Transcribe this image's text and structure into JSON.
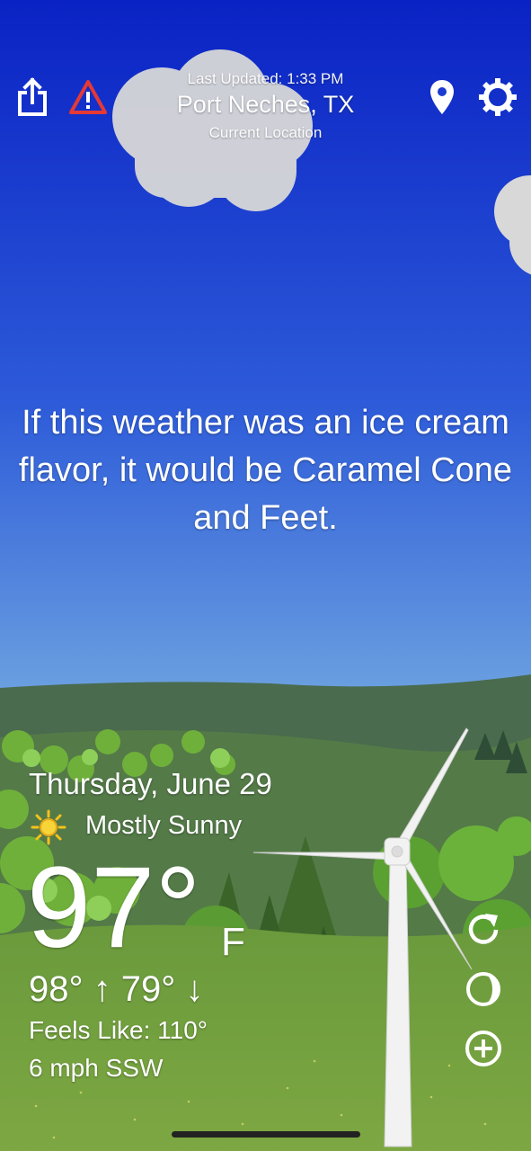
{
  "header": {
    "last_updated": "Last Updated: 1:33 PM",
    "city": "Port Neches, TX",
    "location_sub": "Current Location",
    "icons": [
      "share-icon",
      "alert-icon",
      "location-pin-icon",
      "gear-icon"
    ],
    "alert_color": "#e53935"
  },
  "quote": {
    "text": "If this weather was an ice cream flavor, it would be Caramel Cone and Feet."
  },
  "weather": {
    "date": "Thursday, June 29",
    "condition": "Mostly Sunny",
    "condition_icon": "sun-icon",
    "temperature": "97°",
    "unit": "F",
    "hi_lo": "98° ↑ 79° ↓",
    "feels_like": "Feels Like: 110°",
    "wind": "6 mph SSW"
  },
  "controls": {
    "icons": [
      "refresh-icon",
      "moon-phase-icon",
      "zoom-in-icon"
    ]
  },
  "colors": {
    "sky_top": "#0a2cc8",
    "sky_bottom": "#6a9fe0",
    "grass": "#6f9a3a",
    "text": "#ffffff"
  }
}
